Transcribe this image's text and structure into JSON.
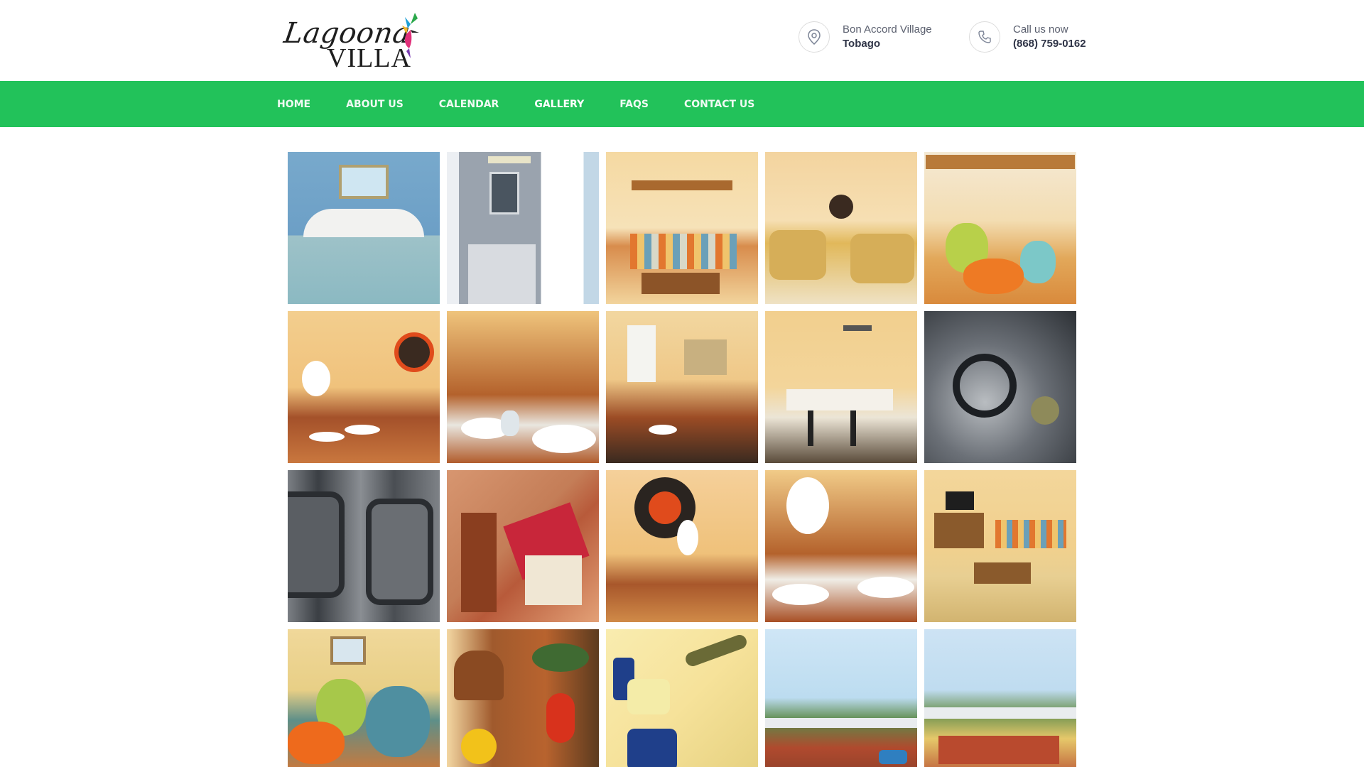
{
  "logo": {
    "script": "Lagoona",
    "villa": "VILLA"
  },
  "contact": {
    "location_line1": "Bon Accord Village",
    "location_line2": "Tobago",
    "phone_line1": "Call us now",
    "phone_line2": "(868) 759-0162"
  },
  "nav": {
    "items": [
      "HOME",
      "ABOUT US",
      "CALENDAR",
      "GALLERY",
      "FAQS",
      "CONTACT US"
    ],
    "active": "GALLERY"
  },
  "colors": {
    "nav_bg": "#22c25a",
    "nav_text": "#ffffff",
    "brand_dark": "#2f3447"
  },
  "gallery": {
    "tiles": [
      "bedroom",
      "bathroom",
      "living-room-sofa",
      "living-room-recliners",
      "decor-vases",
      "dining-table",
      "dining-table-closeup",
      "dining-and-living",
      "kitchen",
      "stove-burners",
      "kitchen-sink",
      "birdhouse-decor",
      "sun-wall-decor",
      "dining-table-setting",
      "living-room-tv",
      "ceramic-vases",
      "lantern-decor",
      "mug-rack",
      "villa-exterior",
      "villa-exterior-driveway"
    ]
  }
}
